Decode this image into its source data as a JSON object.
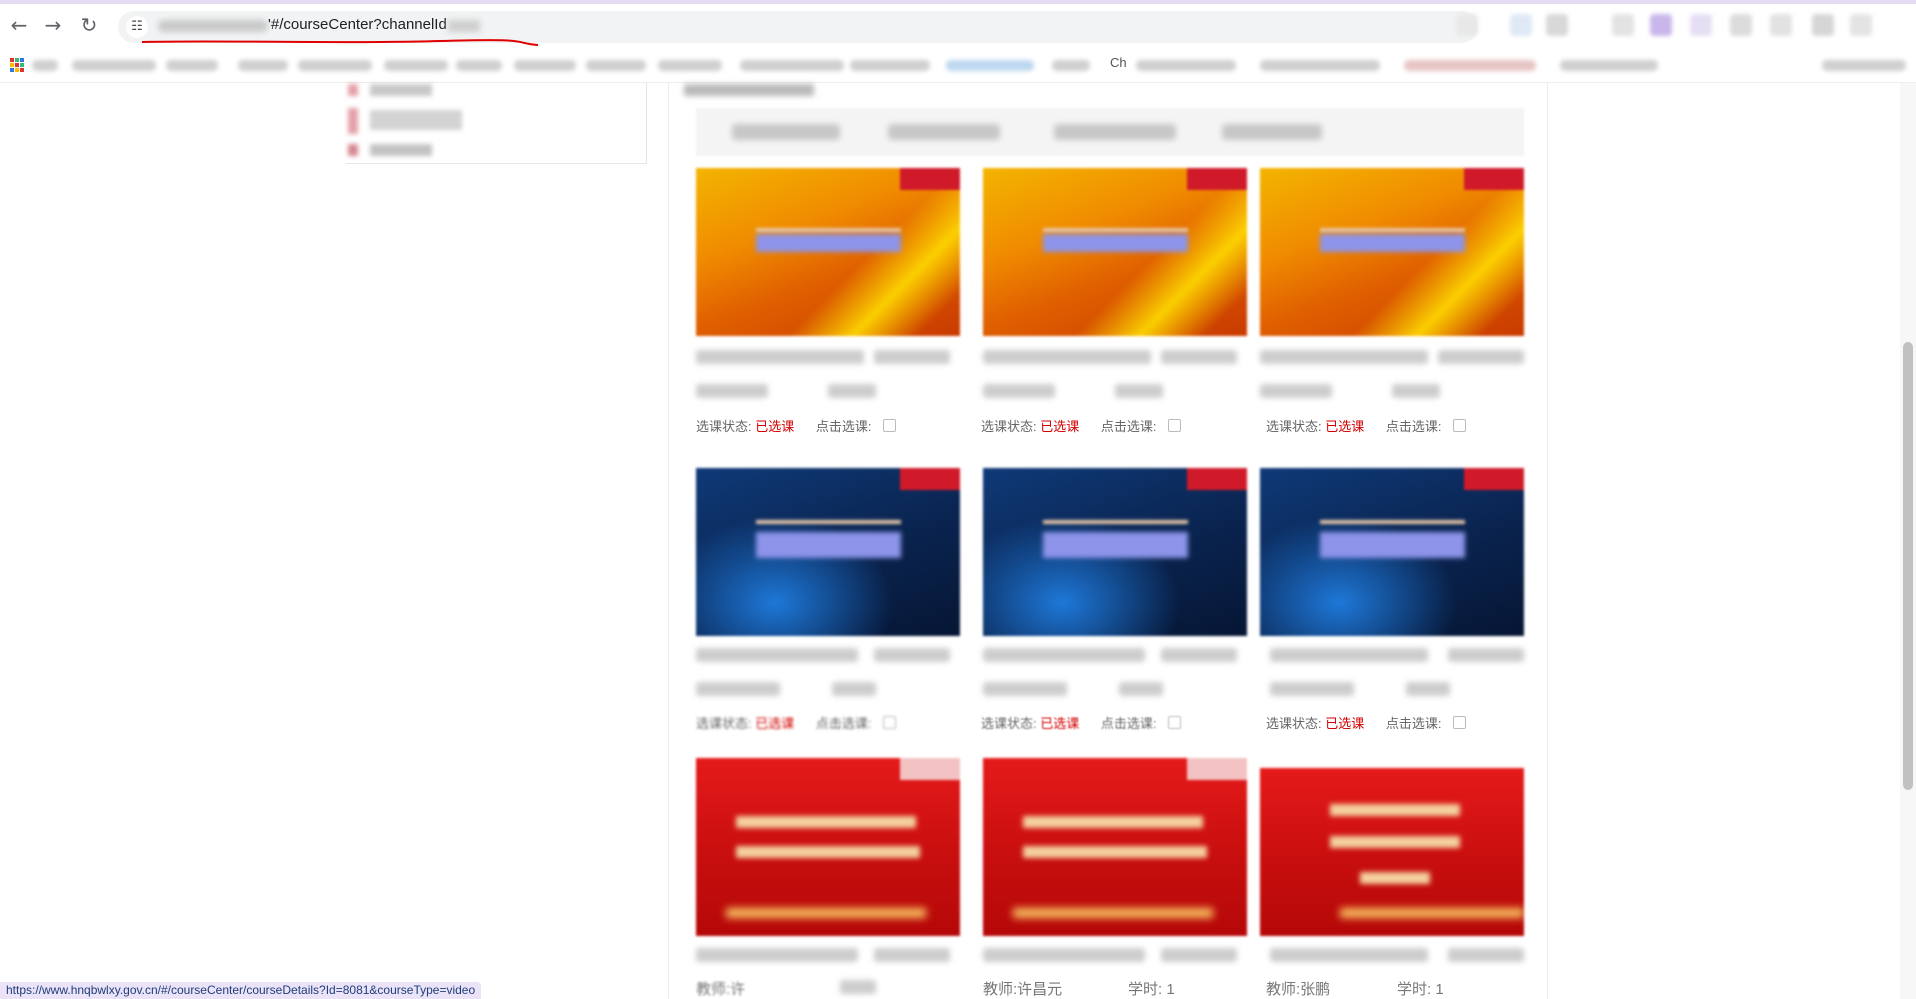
{
  "browser": {
    "url_visible": "'#/courseCenter?channelId",
    "status_url": "https://www.hnqbwlxy.gov.cn/#/courseCenter/courseDetails?Id=8081&courseType=video",
    "bookmark_partial": "Ch",
    "icons": {
      "back": "back-arrow-icon",
      "forward": "forward-arrow-icon",
      "reload": "reload-icon",
      "site_info": "tune-icon",
      "apps": "apps-grid-icon"
    },
    "accent_color": "#e4dcf3"
  },
  "card_labels": {
    "status_label": "选课状态:",
    "selected": "已选课",
    "click_select": "点击选课:"
  },
  "courses": [
    {
      "theme": "orange",
      "teacher": "",
      "hours": ""
    },
    {
      "theme": "orange",
      "teacher": "",
      "hours": ""
    },
    {
      "theme": "orange",
      "teacher": "",
      "hours": ""
    },
    {
      "theme": "blue",
      "teacher": "",
      "hours": ""
    },
    {
      "theme": "blue",
      "teacher": "",
      "hours": ""
    },
    {
      "theme": "blue",
      "teacher": "",
      "hours": ""
    },
    {
      "theme": "red",
      "teacher": "教师:许",
      "hours": ""
    },
    {
      "theme": "red",
      "teacher": "教师:许昌元",
      "hours": "学时: 1"
    },
    {
      "theme": "red",
      "teacher": "教师:张鹏",
      "hours": "学时: 1"
    }
  ],
  "colors": {
    "selected_status": "#d30000",
    "annotation_underline": "#e00000"
  }
}
